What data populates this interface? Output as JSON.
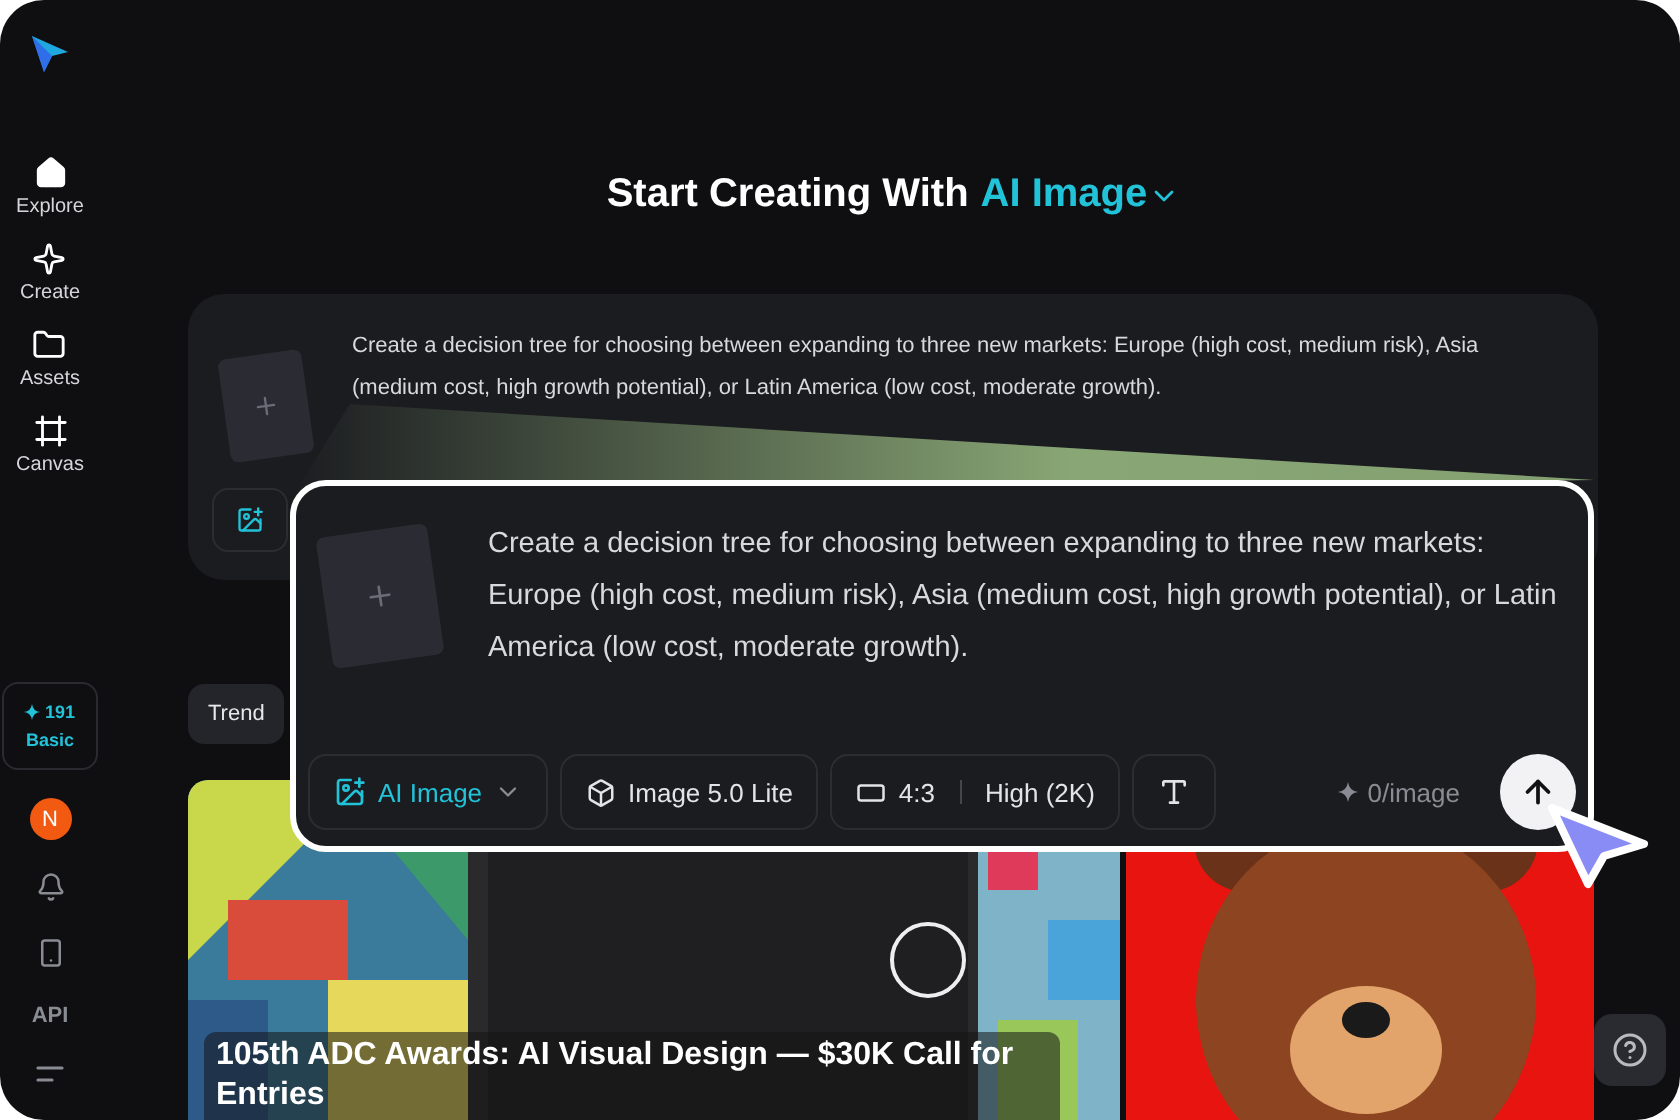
{
  "sidebar": {
    "nav": [
      {
        "label": "Explore"
      },
      {
        "label": "Create"
      },
      {
        "label": "Assets"
      },
      {
        "label": "Canvas"
      }
    ],
    "credits": {
      "count": "191",
      "plan": "Basic"
    },
    "avatar": "N",
    "bottom": [
      {
        "kind": "bell"
      },
      {
        "kind": "phone"
      },
      {
        "kind": "api",
        "label": "API"
      },
      {
        "kind": "menu"
      }
    ]
  },
  "heading": {
    "text": "Start Creating With",
    "mode": "AI Image"
  },
  "prompt_card": {
    "prompt": "Create a decision tree for choosing between expanding to three new markets: Europe (high cost, medium risk), Asia (medium cost, high growth potential), or Latin America (low cost, moderate growth)."
  },
  "tabs": [
    {
      "label": "Trend",
      "selected": true
    }
  ],
  "gallery": [
    {
      "kind": "picture",
      "title": "105th ADC Awards: AI Visual Design — $30K Call for Entries"
    },
    {
      "kind": "picture"
    }
  ],
  "zoomed_prompt": {
    "prompt": "Create a decision tree for choosing between expanding to three new markets: Europe (high cost, medium risk), Asia (medium cost, high growth potential), or Latin America (low cost, moderate growth).",
    "toolbar": {
      "mode": "AI Image",
      "model": "Image 5.0 Lite",
      "ratio": "4:3",
      "quality": "High (2K)",
      "cost": "0/image"
    }
  }
}
